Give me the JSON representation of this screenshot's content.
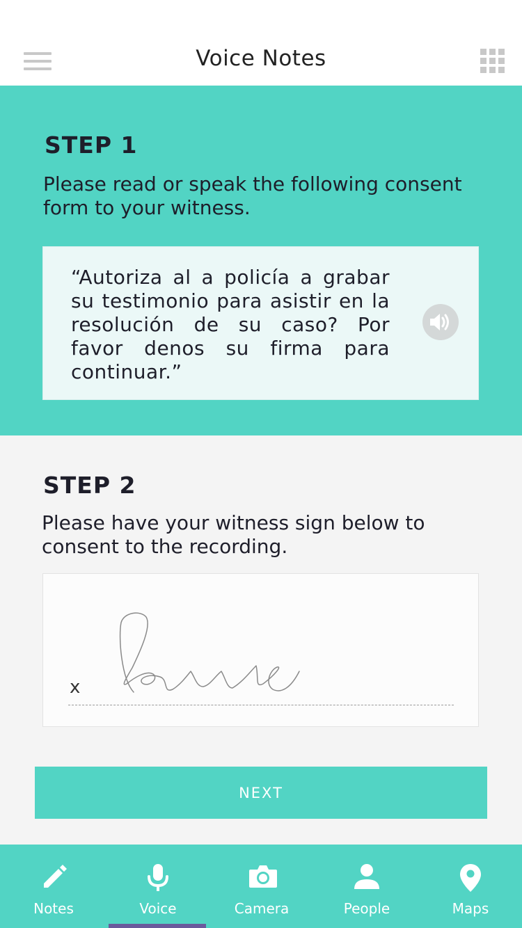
{
  "header": {
    "title": "Voice Notes"
  },
  "step1": {
    "heading": "STEP 1",
    "instruction": "Please read or speak the following consent form to your witness.",
    "consent_text": "“Autoriza al a policía a grabar su testimonio para asistir en la resolución de su caso? Por favor denos su firma para continuar.”"
  },
  "step2": {
    "heading": "STEP 2",
    "instruction": "Please have your witness sign below to consent to the recording.",
    "signature_marker": "x",
    "next_label": "NEXT"
  },
  "tabs": [
    {
      "label": "Notes",
      "icon": "pencil-icon"
    },
    {
      "label": "Voice",
      "icon": "microphone-icon"
    },
    {
      "label": "Camera",
      "icon": "camera-icon"
    },
    {
      "label": "People",
      "icon": "person-icon"
    },
    {
      "label": "Maps",
      "icon": "map-pin-icon"
    }
  ],
  "active_tab": "Voice",
  "colors": {
    "accent": "#52d4c4",
    "tab_indicator": "#6a5a9c",
    "consent_box": "#ebf8f7",
    "step2_background": "#f4f4f4"
  }
}
